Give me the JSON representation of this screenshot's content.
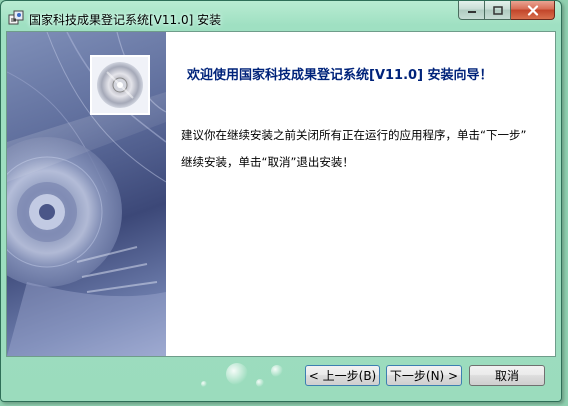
{
  "window": {
    "title": "国家科技成果登记系统[V11.0]  安装"
  },
  "controls": {
    "minimize_icon": "minimize-icon",
    "maximize_icon": "maximize-icon",
    "close_icon": "close-icon"
  },
  "welcome": {
    "title": "欢迎使用国家科技成果登记系统[V11.0]   安装向导！",
    "line1": "建议你在继续安装之前关闭所有正在运行的应用程序，单击“下一步”",
    "line2": "继续安装，单击“取消”退出安装！"
  },
  "buttons": {
    "back": "< 上一步(B)",
    "next": "下一步(N) >",
    "cancel": "取消"
  }
}
